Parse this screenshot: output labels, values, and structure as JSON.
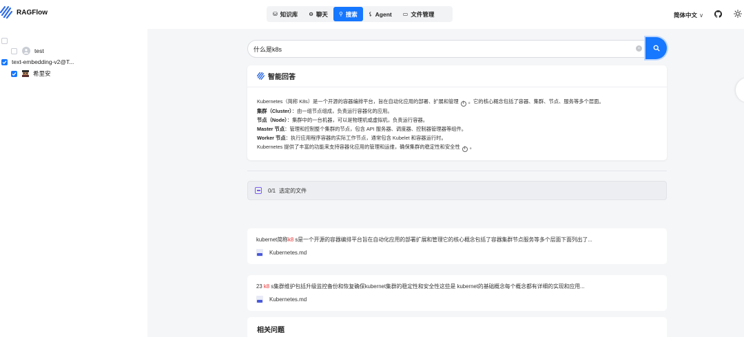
{
  "app": {
    "name": "RAGFlow"
  },
  "nav": [
    {
      "label": "知识库",
      "icon": "database-icon"
    },
    {
      "label": "聊天",
      "icon": "chat-icon"
    },
    {
      "label": "搜索",
      "icon": "search-icon",
      "active": true
    },
    {
      "label": "Agent",
      "icon": "agent-icon"
    },
    {
      "label": "文件管理",
      "icon": "folder-icon"
    }
  ],
  "header_right": {
    "language": "简体中文",
    "language_chevron": "∨"
  },
  "sidebar": {
    "users": [
      {
        "name": "test",
        "checked": false
      },
      {
        "name": "希里安",
        "checked": true
      }
    ],
    "model": {
      "name": "text-embedding-v2@T...",
      "checked": true
    }
  },
  "search": {
    "query": "什么是k8s",
    "clear_glyph": "×"
  },
  "answer": {
    "title": "智能回答",
    "lines": [
      {
        "text": "Kubernetes（简称 K8s）是一个开源的容器编排平台，旨在自动化应用的部署、扩展和管理",
        "suffix": "。它的核心概念包括了容器、集群、节点、服务等多个层面。"
      },
      {
        "bold": "集群（Cluster）",
        "text": "：由一组节点组成，负责运行容器化的应用。"
      },
      {
        "bold": "节点（Node）",
        "text": "：集群中的一台机器，可以是物理机或虚拟机，负责运行容器。"
      },
      {
        "bold": "Master 节点",
        "text": "：管理和控制整个集群的节点，包含 API 服务器、调度器、控制器管理器等组件。"
      },
      {
        "bold": "Worker 节点",
        "text": "：执行应用程序容器的实际工作节点，通常包含 Kubelet 和容器运行时。"
      },
      {
        "text": "Kubernetes 提供了丰富的功能来支持容器化应用的管理和运维，确保集群的稳定性和安全性",
        "suffix": "。"
      }
    ],
    "info_glyph": "i"
  },
  "file_selection": {
    "count": "0/1",
    "label": "选定的文件"
  },
  "results": [
    {
      "before": "kubernet简称",
      "highlight": "k8",
      "after": " s是一个开源的容器编排平台旨在自动化应用的部署扩展和管理它的核心概念包括了容器集群节点服务等多个层面下面列出了...",
      "file": "Kubernetes.md"
    },
    {
      "before": "23 ",
      "highlight": "k8",
      "after": " s集群维护包括升级监控备份和恢复确保kubernet集群的稳定性和安全性这些是 kubernet的基础概念每个概念都有详细的实现和应用...",
      "file": "Kubernetes.md"
    }
  ],
  "related": {
    "title": "相关问题"
  },
  "colors": {
    "accent": "#1677ff",
    "highlight": "#e8312f",
    "purple": "#7c5cf0"
  }
}
